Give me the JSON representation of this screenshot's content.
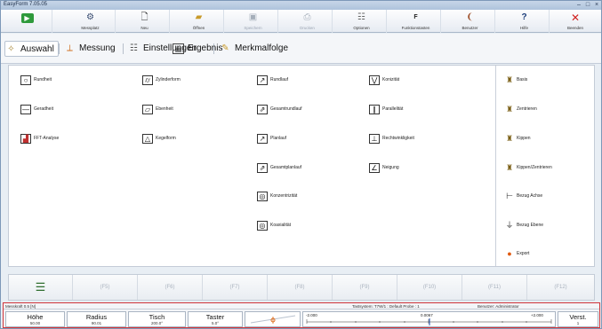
{
  "window": {
    "title": "EasyForm 7.05.05"
  },
  "toolbar": [
    {
      "label": "",
      "icon": "play-icon",
      "enabled": true
    },
    {
      "label": "Messplatz",
      "icon": "machine-icon",
      "enabled": true
    },
    {
      "label": "Neu",
      "icon": "new-document-icon",
      "enabled": true
    },
    {
      "label": "Öffnen",
      "icon": "open-folder-icon",
      "enabled": true
    },
    {
      "label": "Speichern",
      "icon": "save-icon",
      "enabled": false
    },
    {
      "label": "Drucken",
      "icon": "print-icon",
      "enabled": false
    },
    {
      "label": "Optionen",
      "icon": "options-icon",
      "enabled": true
    },
    {
      "label": "Funktionstasten",
      "icon": "function-keys-icon",
      "enabled": true
    },
    {
      "label": "Benutzer",
      "icon": "user-icon",
      "enabled": true
    },
    {
      "label": "Hilfe",
      "icon": "help-icon",
      "enabled": true
    },
    {
      "label": "Beenden",
      "icon": "close-icon",
      "enabled": true
    }
  ],
  "tabs": [
    {
      "label": "Auswahl",
      "selected": true
    },
    {
      "label": "Messung",
      "selected": false
    },
    {
      "label": "Einstellungen",
      "selected": false
    },
    {
      "label": "Ergebnis",
      "selected": false
    },
    {
      "label": "Merkmalfolge",
      "selected": false
    }
  ],
  "features": {
    "col1": [
      "Rundheit",
      "Geradheit",
      "FFT-Analyse"
    ],
    "col2": [
      "Zylinderform",
      "Ebenheit",
      "Kegelform"
    ],
    "col3": [
      "Rundlauf",
      "Gesamtrundlauf",
      "Planlauf",
      "Gesamtplanlauf",
      "Konzentrizität",
      "Koaxialität"
    ],
    "col4": [
      "Konizität",
      "Parallelität",
      "Rechtwinkligkeit",
      "Neigung"
    ]
  },
  "right_panel": [
    "Basis",
    "Zentrieren",
    "Kippen",
    "Kippen/Zentrieren",
    "Bezug Achse",
    "Bezug Ebene",
    "Export"
  ],
  "function_keys": [
    "",
    "(F5)",
    "(F6)",
    "(F7)",
    "(F8)",
    "(F9)",
    "(F10)",
    "(F11)",
    "(F12)"
  ],
  "status": {
    "left": "Messkraft 0.5 [N]",
    "middle": "Tastsystem: T7W/1 : Default Probe : 1",
    "right": "Benutzer: Administrator",
    "measures": [
      {
        "name": "Höhe",
        "value": "50.00"
      },
      {
        "name": "Radius",
        "value": "90.01"
      },
      {
        "name": "Tisch",
        "value": "200.0°"
      },
      {
        "name": "Taster",
        "value": "5.0°"
      }
    ],
    "scale_min": "-2.000",
    "scale_mid": "0.0067",
    "scale_max": "+2.000",
    "verst_label": "Verst.",
    "verst_value": "1"
  }
}
